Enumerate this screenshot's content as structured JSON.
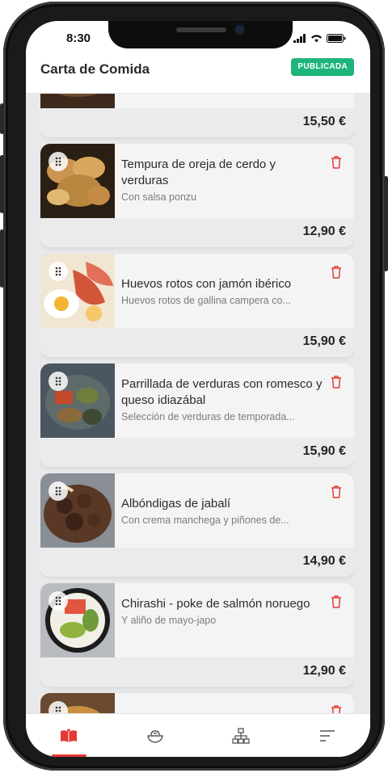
{
  "status_bar": {
    "time": "8:30"
  },
  "header": {
    "title": "Carta de Comida",
    "badge": "PUBLICADA",
    "badge_color": "#1fb57a"
  },
  "accent_color": "#e53935",
  "items": [
    {
      "name": "",
      "description": "",
      "price": "15,50 €",
      "thumb": "food-photo"
    },
    {
      "name": "Tempura de oreja de cerdo y verduras",
      "description": "Con salsa ponzu",
      "price": "12,90 €",
      "thumb": "tempura-photo"
    },
    {
      "name": "Huevos rotos con jamón ibérico",
      "description": "Huevos rotos de gallina campera co...",
      "price": "15,90 €",
      "thumb": "huevos-photo"
    },
    {
      "name": "Parrillada de verduras con romesco y queso idiazábal",
      "description": "Selección de verduras de temporada...",
      "price": "15,90 €",
      "thumb": "parrillada-photo"
    },
    {
      "name": "Albóndigas de jabalí",
      "description": "Con crema manchega y piñones de...",
      "price": "14,90 €",
      "thumb": "albondigas-photo"
    },
    {
      "name": "Chirashi - poke de salmón noruego",
      "description": "Y aliño de mayo-japo",
      "price": "12,90 €",
      "thumb": "chirashi-photo"
    },
    {
      "name": "",
      "description": "",
      "price": "",
      "thumb": "food-photo"
    }
  ],
  "bottom_nav": [
    {
      "icon": "menu-book-icon",
      "active": true
    },
    {
      "icon": "bowl-icon",
      "active": false
    },
    {
      "icon": "hierarchy-icon",
      "active": false
    },
    {
      "icon": "sort-icon",
      "active": false
    }
  ]
}
